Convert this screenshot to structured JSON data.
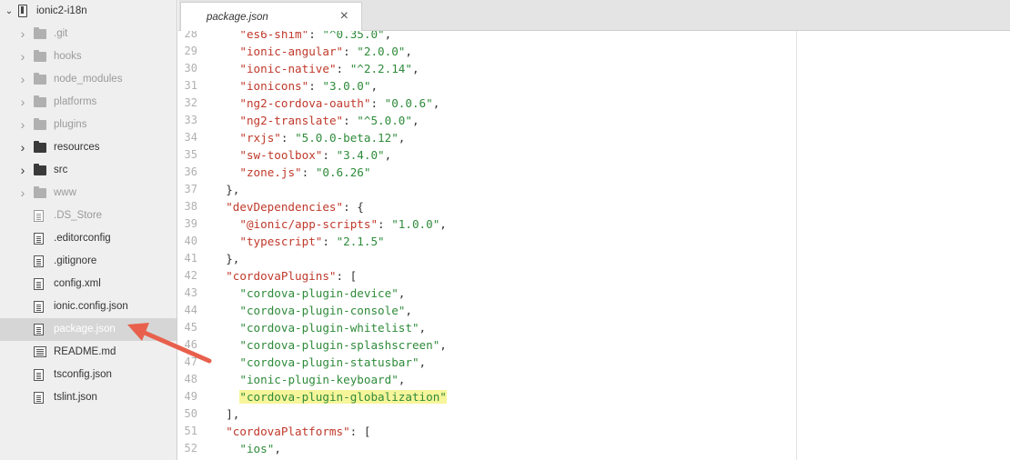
{
  "sidebar": {
    "project": "ionic2-i18n",
    "items": [
      {
        "label": ".git",
        "kind": "folder",
        "faded": true,
        "expandable": true
      },
      {
        "label": "hooks",
        "kind": "folder",
        "faded": true,
        "expandable": true
      },
      {
        "label": "node_modules",
        "kind": "folder",
        "faded": true,
        "expandable": true
      },
      {
        "label": "platforms",
        "kind": "folder",
        "faded": true,
        "expandable": true
      },
      {
        "label": "plugins",
        "kind": "folder",
        "faded": true,
        "expandable": true
      },
      {
        "label": "resources",
        "kind": "folder",
        "faded": false,
        "expandable": true
      },
      {
        "label": "src",
        "kind": "folder",
        "faded": false,
        "expandable": true
      },
      {
        "label": "www",
        "kind": "folder",
        "faded": true,
        "expandable": true
      },
      {
        "label": ".DS_Store",
        "kind": "file",
        "faded": true
      },
      {
        "label": ".editorconfig",
        "kind": "file",
        "faded": false
      },
      {
        "label": ".gitignore",
        "kind": "file",
        "faded": false
      },
      {
        "label": "config.xml",
        "kind": "file",
        "faded": false
      },
      {
        "label": "ionic.config.json",
        "kind": "file",
        "faded": false
      },
      {
        "label": "package.json",
        "kind": "file",
        "faded": false,
        "selected": true
      },
      {
        "label": "README.md",
        "kind": "readme",
        "faded": false
      },
      {
        "label": "tsconfig.json",
        "kind": "file",
        "faded": false
      },
      {
        "label": "tslint.json",
        "kind": "file",
        "faded": false
      }
    ]
  },
  "tab": {
    "label": "package.json",
    "close": "×"
  },
  "editor": {
    "lines": [
      {
        "n": "28",
        "indent": 4,
        "parts": [
          [
            "key",
            "\"es6-shim\""
          ],
          [
            "plain",
            ": "
          ],
          [
            "str",
            "\"^0.35.0\""
          ],
          [
            "plain",
            ","
          ]
        ]
      },
      {
        "n": "29",
        "indent": 4,
        "parts": [
          [
            "key",
            "\"ionic-angular\""
          ],
          [
            "plain",
            ": "
          ],
          [
            "str",
            "\"2.0.0\""
          ],
          [
            "plain",
            ","
          ]
        ]
      },
      {
        "n": "30",
        "indent": 4,
        "parts": [
          [
            "key",
            "\"ionic-native\""
          ],
          [
            "plain",
            ": "
          ],
          [
            "str",
            "\"^2.2.14\""
          ],
          [
            "plain",
            ","
          ]
        ]
      },
      {
        "n": "31",
        "indent": 4,
        "parts": [
          [
            "key",
            "\"ionicons\""
          ],
          [
            "plain",
            ": "
          ],
          [
            "str",
            "\"3.0.0\""
          ],
          [
            "plain",
            ","
          ]
        ]
      },
      {
        "n": "32",
        "indent": 4,
        "parts": [
          [
            "key",
            "\"ng2-cordova-oauth\""
          ],
          [
            "plain",
            ": "
          ],
          [
            "str",
            "\"0.0.6\""
          ],
          [
            "plain",
            ","
          ]
        ]
      },
      {
        "n": "33",
        "indent": 4,
        "parts": [
          [
            "key",
            "\"ng2-translate\""
          ],
          [
            "plain",
            ": "
          ],
          [
            "str",
            "\"^5.0.0\""
          ],
          [
            "plain",
            ","
          ]
        ]
      },
      {
        "n": "34",
        "indent": 4,
        "parts": [
          [
            "key",
            "\"rxjs\""
          ],
          [
            "plain",
            ": "
          ],
          [
            "str",
            "\"5.0.0-beta.12\""
          ],
          [
            "plain",
            ","
          ]
        ]
      },
      {
        "n": "35",
        "indent": 4,
        "parts": [
          [
            "key",
            "\"sw-toolbox\""
          ],
          [
            "plain",
            ": "
          ],
          [
            "str",
            "\"3.4.0\""
          ],
          [
            "plain",
            ","
          ]
        ]
      },
      {
        "n": "36",
        "indent": 4,
        "parts": [
          [
            "key",
            "\"zone.js\""
          ],
          [
            "plain",
            ": "
          ],
          [
            "str",
            "\"0.6.26\""
          ]
        ]
      },
      {
        "n": "37",
        "indent": 2,
        "parts": [
          [
            "plain",
            "},"
          ]
        ]
      },
      {
        "n": "38",
        "indent": 2,
        "parts": [
          [
            "key",
            "\"devDependencies\""
          ],
          [
            "plain",
            ": {"
          ]
        ]
      },
      {
        "n": "39",
        "indent": 4,
        "parts": [
          [
            "key",
            "\"@ionic/app-scripts\""
          ],
          [
            "plain",
            ": "
          ],
          [
            "str",
            "\"1.0.0\""
          ],
          [
            "plain",
            ","
          ]
        ]
      },
      {
        "n": "40",
        "indent": 4,
        "parts": [
          [
            "key",
            "\"typescript\""
          ],
          [
            "plain",
            ": "
          ],
          [
            "str",
            "\"2.1.5\""
          ]
        ]
      },
      {
        "n": "41",
        "indent": 2,
        "parts": [
          [
            "plain",
            "},"
          ]
        ]
      },
      {
        "n": "42",
        "indent": 2,
        "parts": [
          [
            "key",
            "\"cordovaPlugins\""
          ],
          [
            "plain",
            ": ["
          ]
        ]
      },
      {
        "n": "43",
        "indent": 4,
        "parts": [
          [
            "str",
            "\"cordova-plugin-device\""
          ],
          [
            "plain",
            ","
          ]
        ]
      },
      {
        "n": "44",
        "indent": 4,
        "parts": [
          [
            "str",
            "\"cordova-plugin-console\""
          ],
          [
            "plain",
            ","
          ]
        ]
      },
      {
        "n": "45",
        "indent": 4,
        "parts": [
          [
            "str",
            "\"cordova-plugin-whitelist\""
          ],
          [
            "plain",
            ","
          ]
        ]
      },
      {
        "n": "46",
        "indent": 4,
        "parts": [
          [
            "str",
            "\"cordova-plugin-splashscreen\""
          ],
          [
            "plain",
            ","
          ]
        ]
      },
      {
        "n": "47",
        "indent": 4,
        "parts": [
          [
            "str",
            "\"cordova-plugin-statusbar\""
          ],
          [
            "plain",
            ","
          ]
        ]
      },
      {
        "n": "48",
        "indent": 4,
        "parts": [
          [
            "str",
            "\"ionic-plugin-keyboard\""
          ],
          [
            "plain",
            ","
          ]
        ]
      },
      {
        "n": "49",
        "indent": 4,
        "parts": [
          [
            "hl",
            "\"cordova-plugin-globalization\""
          ]
        ]
      },
      {
        "n": "50",
        "indent": 2,
        "parts": [
          [
            "plain",
            "],"
          ]
        ]
      },
      {
        "n": "51",
        "indent": 2,
        "parts": [
          [
            "key",
            "\"cordovaPlatforms\""
          ],
          [
            "plain",
            ": ["
          ]
        ]
      },
      {
        "n": "52",
        "indent": 4,
        "parts": [
          [
            "str",
            "\"ios\""
          ],
          [
            "plain",
            ","
          ]
        ]
      }
    ]
  },
  "colors": {
    "string": "#2e8b3a",
    "key": "#c0392b",
    "highlight": "#f7f59a",
    "arrow": "#e8604c",
    "selected_row": "#d6d6d6"
  }
}
